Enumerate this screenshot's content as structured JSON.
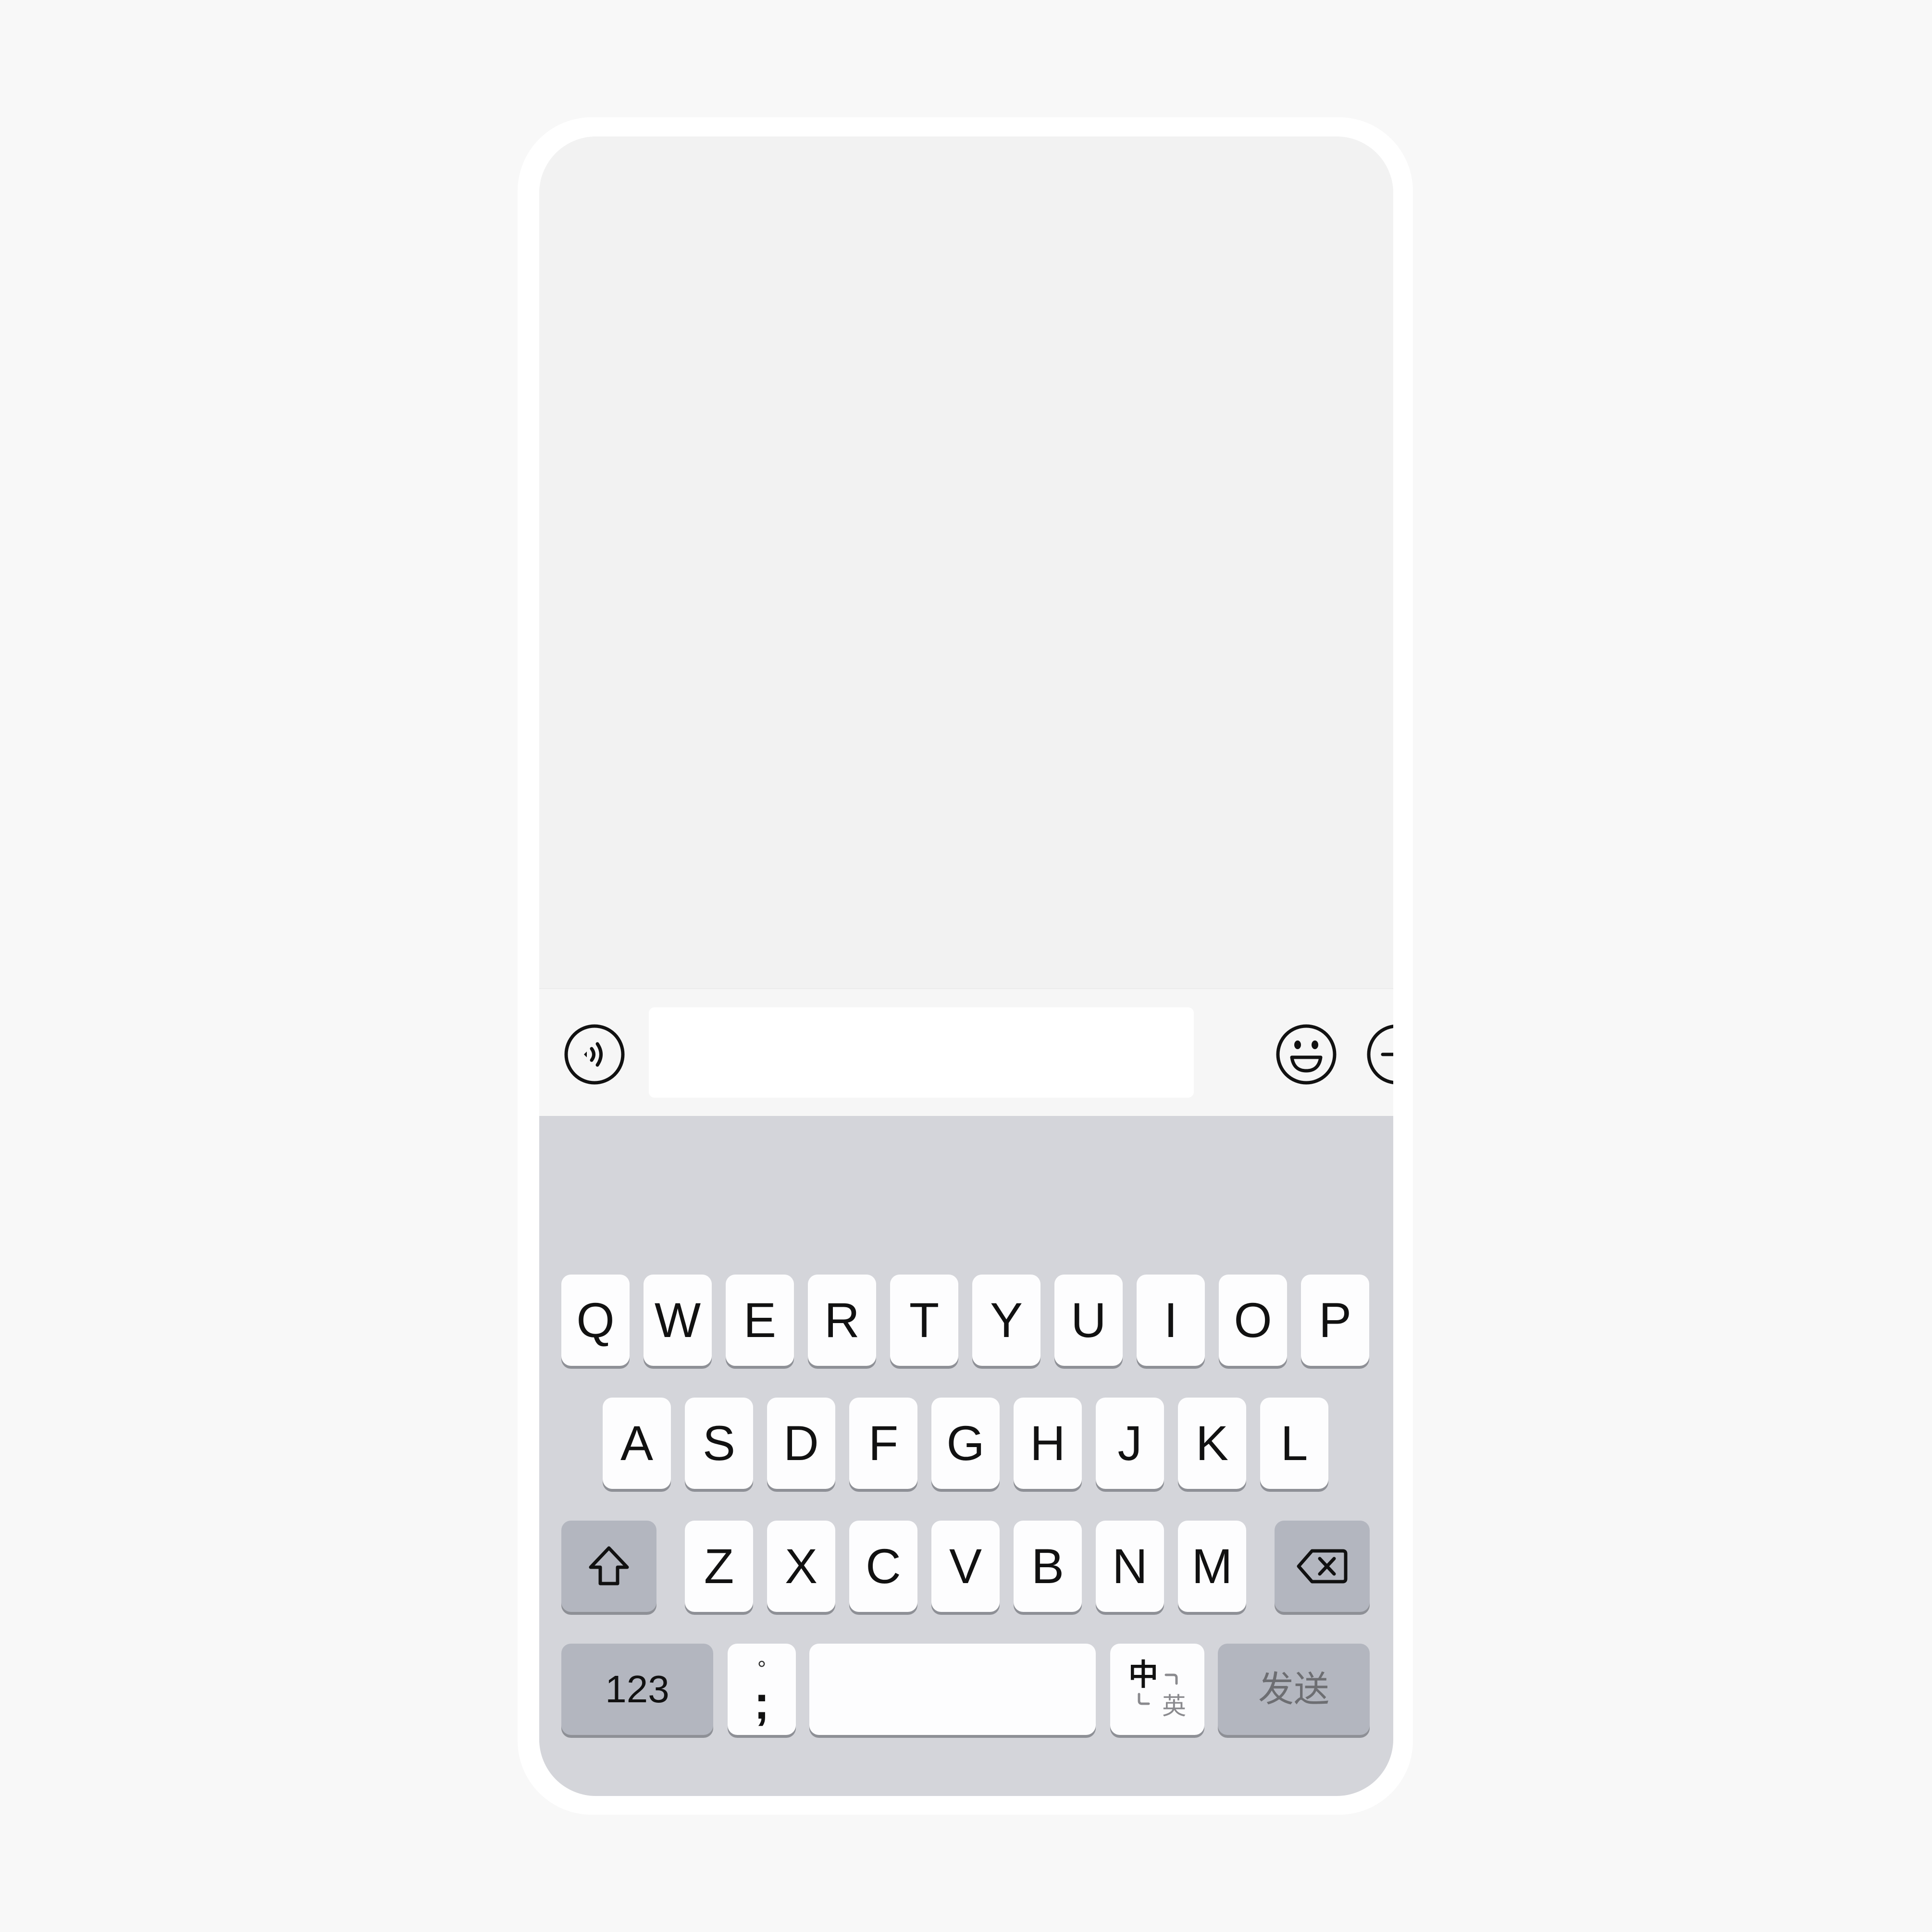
{
  "chat": {
    "input": {
      "value": "",
      "placeholder": ""
    },
    "voice_button_icon": "voice-icon",
    "emoji_button_icon": "emoji-icon",
    "plus_button_icon": "plus-icon"
  },
  "keyboard": {
    "row1": [
      "Q",
      "W",
      "E",
      "R",
      "T",
      "Y",
      "U",
      "I",
      "O",
      "P"
    ],
    "row2": [
      "A",
      "S",
      "D",
      "F",
      "G",
      "H",
      "J",
      "K",
      "L"
    ],
    "row3": [
      "Z",
      "X",
      "C",
      "V",
      "B",
      "N",
      "M"
    ],
    "shift_icon": "shift-icon",
    "backspace_icon": "backspace-icon",
    "numbers_label": "123",
    "punct_top": "°",
    "punct_main": ";",
    "space_label": "",
    "lang_primary": "中",
    "lang_secondary": "英",
    "send_label": "发送"
  },
  "colors": {
    "page_background": "#f8f8f8",
    "screen_background": "#f2f2f2",
    "keyboard_background": "#d4d5da",
    "key_light": "#fdfdfe",
    "key_dark": "#b3b6bf"
  }
}
